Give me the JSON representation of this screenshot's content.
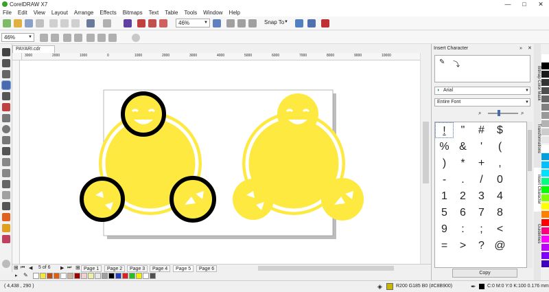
{
  "window": {
    "title": "CorelDRAW X7",
    "minimize": "—",
    "maximize": "□",
    "close": "✕"
  },
  "menu": [
    "File",
    "Edit",
    "View",
    "Layout",
    "Arrange",
    "Effects",
    "Bitmaps",
    "Text",
    "Table",
    "Tools",
    "Window",
    "Help"
  ],
  "toolbar": {
    "zoom_top": "46%",
    "snap_to": "Snap To",
    "zoom_prop": "46%"
  },
  "document": {
    "tab": "PAYARI.cdr"
  },
  "ruler_labels": [
    "3000",
    "2000",
    "1000",
    "0",
    "1000",
    "2000",
    "3000",
    "4000",
    "5000",
    "6000",
    "7000",
    "8000",
    "9000",
    "10000"
  ],
  "pages": {
    "counter": "5 of 6",
    "tabs": [
      "Page 1",
      "Page 2",
      "Page 3",
      "Page 4",
      "Page 5",
      "Page 6"
    ],
    "active": 4
  },
  "status": {
    "coordinates": "( 4,438 , 290 )",
    "fill_info": "R200 G185 B0 (#C8B900)",
    "outline_info": "C:0 M:0 Y:0 K:100  0.176 mm"
  },
  "docker": {
    "title": "Insert Character",
    "font": "Arial",
    "subset": "Entire Font",
    "chars": [
      "!",
      "\"",
      "#",
      "$",
      "%",
      "&",
      "'",
      "(",
      ")",
      "*",
      "+",
      ",",
      "-",
      ".",
      "/",
      "0",
      "1",
      "2",
      "3",
      "4",
      "5",
      "6",
      "7",
      "8",
      "9",
      ":",
      ";",
      "<",
      "=",
      ">",
      "?",
      "@"
    ],
    "copy": "Copy"
  },
  "side_tabs": [
    "Bitmap Color Mask",
    "Transformations",
    "Insert Character",
    "Guidelines"
  ],
  "colors": {
    "art_yellow": "#FDE940",
    "outline": "#000000",
    "palette": [
      "#ffffff",
      "#000000",
      "#1a1a1a",
      "#333333",
      "#4d4d4d",
      "#666666",
      "#808080",
      "#999999",
      "#b3b3b3",
      "#cccccc",
      "#e6e6e6",
      "#ffffff",
      "#00a0e0",
      "#00b0f0",
      "#00c0ff",
      "#00e0ff",
      "#00ff80",
      "#00ff00",
      "#80ff00",
      "#ffff00",
      "#ff8000",
      "#ff0000",
      "#ff0080",
      "#ff00ff",
      "#c000ff",
      "#8000ff"
    ],
    "bottom_palette": [
      "#f5e637",
      "#c04a10",
      "#e06010",
      "#ffffff",
      "#c8b2a0",
      "#a00000",
      "#f0d0d0",
      "#f0f0a0",
      "#e8e8e8",
      "#a0a0a0",
      "#000000",
      "#2040c0",
      "#e02020",
      "#20c020",
      "#f0f000",
      "#ffffff",
      "#505050"
    ]
  }
}
